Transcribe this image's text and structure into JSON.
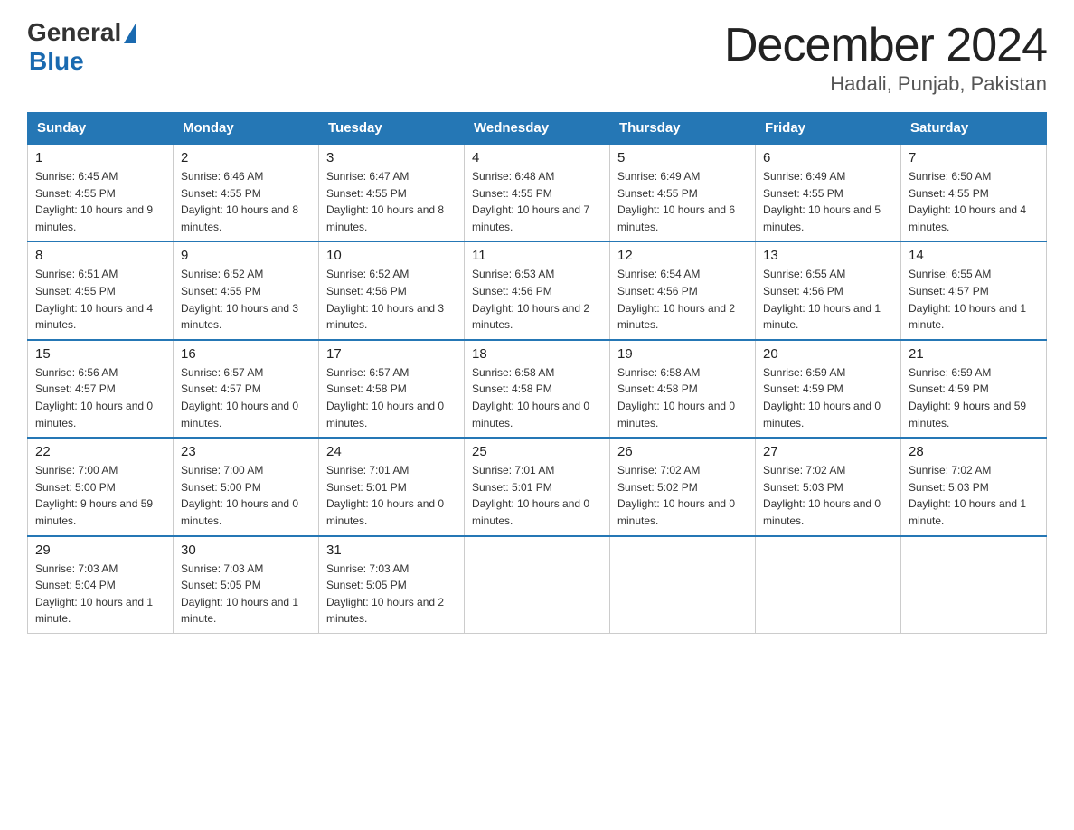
{
  "logo": {
    "text_general": "General",
    "text_blue": "Blue",
    "triangle": "▲"
  },
  "title": {
    "month_year": "December 2024",
    "location": "Hadali, Punjab, Pakistan"
  },
  "weekdays": [
    "Sunday",
    "Monday",
    "Tuesday",
    "Wednesday",
    "Thursday",
    "Friday",
    "Saturday"
  ],
  "weeks": [
    [
      {
        "day": "1",
        "sunrise": "6:45 AM",
        "sunset": "4:55 PM",
        "daylight": "10 hours and 9 minutes."
      },
      {
        "day": "2",
        "sunrise": "6:46 AM",
        "sunset": "4:55 PM",
        "daylight": "10 hours and 8 minutes."
      },
      {
        "day": "3",
        "sunrise": "6:47 AM",
        "sunset": "4:55 PM",
        "daylight": "10 hours and 8 minutes."
      },
      {
        "day": "4",
        "sunrise": "6:48 AM",
        "sunset": "4:55 PM",
        "daylight": "10 hours and 7 minutes."
      },
      {
        "day": "5",
        "sunrise": "6:49 AM",
        "sunset": "4:55 PM",
        "daylight": "10 hours and 6 minutes."
      },
      {
        "day": "6",
        "sunrise": "6:49 AM",
        "sunset": "4:55 PM",
        "daylight": "10 hours and 5 minutes."
      },
      {
        "day": "7",
        "sunrise": "6:50 AM",
        "sunset": "4:55 PM",
        "daylight": "10 hours and 4 minutes."
      }
    ],
    [
      {
        "day": "8",
        "sunrise": "6:51 AM",
        "sunset": "4:55 PM",
        "daylight": "10 hours and 4 minutes."
      },
      {
        "day": "9",
        "sunrise": "6:52 AM",
        "sunset": "4:55 PM",
        "daylight": "10 hours and 3 minutes."
      },
      {
        "day": "10",
        "sunrise": "6:52 AM",
        "sunset": "4:56 PM",
        "daylight": "10 hours and 3 minutes."
      },
      {
        "day": "11",
        "sunrise": "6:53 AM",
        "sunset": "4:56 PM",
        "daylight": "10 hours and 2 minutes."
      },
      {
        "day": "12",
        "sunrise": "6:54 AM",
        "sunset": "4:56 PM",
        "daylight": "10 hours and 2 minutes."
      },
      {
        "day": "13",
        "sunrise": "6:55 AM",
        "sunset": "4:56 PM",
        "daylight": "10 hours and 1 minute."
      },
      {
        "day": "14",
        "sunrise": "6:55 AM",
        "sunset": "4:57 PM",
        "daylight": "10 hours and 1 minute."
      }
    ],
    [
      {
        "day": "15",
        "sunrise": "6:56 AM",
        "sunset": "4:57 PM",
        "daylight": "10 hours and 0 minutes."
      },
      {
        "day": "16",
        "sunrise": "6:57 AM",
        "sunset": "4:57 PM",
        "daylight": "10 hours and 0 minutes."
      },
      {
        "day": "17",
        "sunrise": "6:57 AM",
        "sunset": "4:58 PM",
        "daylight": "10 hours and 0 minutes."
      },
      {
        "day": "18",
        "sunrise": "6:58 AM",
        "sunset": "4:58 PM",
        "daylight": "10 hours and 0 minutes."
      },
      {
        "day": "19",
        "sunrise": "6:58 AM",
        "sunset": "4:58 PM",
        "daylight": "10 hours and 0 minutes."
      },
      {
        "day": "20",
        "sunrise": "6:59 AM",
        "sunset": "4:59 PM",
        "daylight": "10 hours and 0 minutes."
      },
      {
        "day": "21",
        "sunrise": "6:59 AM",
        "sunset": "4:59 PM",
        "daylight": "9 hours and 59 minutes."
      }
    ],
    [
      {
        "day": "22",
        "sunrise": "7:00 AM",
        "sunset": "5:00 PM",
        "daylight": "9 hours and 59 minutes."
      },
      {
        "day": "23",
        "sunrise": "7:00 AM",
        "sunset": "5:00 PM",
        "daylight": "10 hours and 0 minutes."
      },
      {
        "day": "24",
        "sunrise": "7:01 AM",
        "sunset": "5:01 PM",
        "daylight": "10 hours and 0 minutes."
      },
      {
        "day": "25",
        "sunrise": "7:01 AM",
        "sunset": "5:01 PM",
        "daylight": "10 hours and 0 minutes."
      },
      {
        "day": "26",
        "sunrise": "7:02 AM",
        "sunset": "5:02 PM",
        "daylight": "10 hours and 0 minutes."
      },
      {
        "day": "27",
        "sunrise": "7:02 AM",
        "sunset": "5:03 PM",
        "daylight": "10 hours and 0 minutes."
      },
      {
        "day": "28",
        "sunrise": "7:02 AM",
        "sunset": "5:03 PM",
        "daylight": "10 hours and 1 minute."
      }
    ],
    [
      {
        "day": "29",
        "sunrise": "7:03 AM",
        "sunset": "5:04 PM",
        "daylight": "10 hours and 1 minute."
      },
      {
        "day": "30",
        "sunrise": "7:03 AM",
        "sunset": "5:05 PM",
        "daylight": "10 hours and 1 minute."
      },
      {
        "day": "31",
        "sunrise": "7:03 AM",
        "sunset": "5:05 PM",
        "daylight": "10 hours and 2 minutes."
      },
      null,
      null,
      null,
      null
    ]
  ],
  "labels": {
    "sunrise": "Sunrise:",
    "sunset": "Sunset:",
    "daylight": "Daylight:"
  }
}
